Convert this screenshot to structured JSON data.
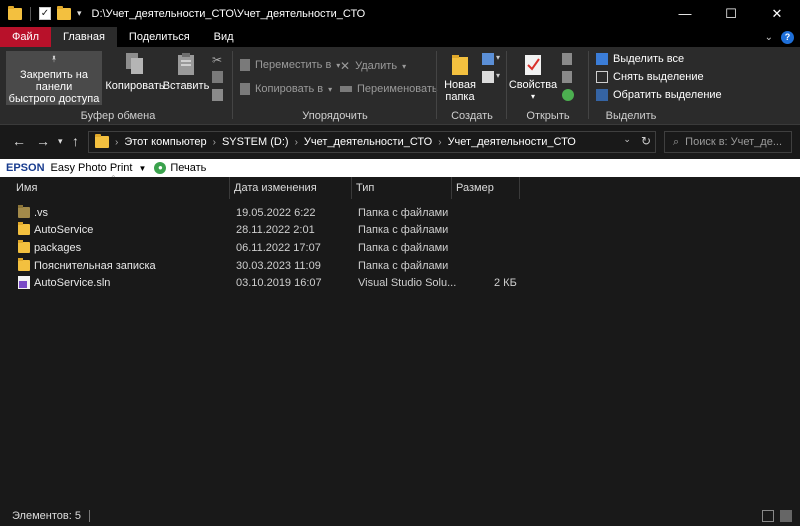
{
  "window": {
    "title": "D:\\Учет_деятельности_СТО\\Учет_деятельности_СТО",
    "minimize": "—",
    "maximize": "☐",
    "close": "✕"
  },
  "tabs": [
    {
      "label": "Файл"
    },
    {
      "label": "Главная"
    },
    {
      "label": "Поделиться"
    },
    {
      "label": "Вид"
    }
  ],
  "ribbon": {
    "clipboard": {
      "label": "Буфер обмена",
      "pin_line1": "Закрепить на панели",
      "pin_line2": "быстрого доступа",
      "copy": "Копировать",
      "paste": "Вставить"
    },
    "organize": {
      "label": "Упорядочить",
      "move_to": "Переместить в",
      "copy_to": "Копировать в",
      "delete": "Удалить",
      "rename": "Переименовать"
    },
    "create": {
      "label": "Создать",
      "new_folder_line1": "Новая",
      "new_folder_line2": "папка"
    },
    "open": {
      "label": "Открыть",
      "properties": "Свойства"
    },
    "select": {
      "label": "Выделить",
      "select_all": "Выделить все",
      "select_none": "Снять выделение",
      "invert": "Обратить выделение"
    }
  },
  "address": {
    "crumbs": [
      "Этот компьютер",
      "SYSTEM (D:)",
      "Учет_деятельности_СТО",
      "Учет_деятельности_СТО"
    ],
    "search_placeholder": "Поиск в: Учет_де..."
  },
  "epson": {
    "brand": "EPSON",
    "app": "Easy Photo Print",
    "print": "Печать"
  },
  "columns": {
    "name": "Имя",
    "date": "Дата изменения",
    "type": "Тип",
    "size": "Размер"
  },
  "files": [
    {
      "name": ".vs",
      "date": "19.05.2022 6:22",
      "type": "Папка с файлами",
      "size": "",
      "icon": "hidden-folder-icon"
    },
    {
      "name": "AutoService",
      "date": "28.11.2022 2:01",
      "type": "Папка с файлами",
      "size": "",
      "icon": "folder-icon"
    },
    {
      "name": "packages",
      "date": "06.11.2022 17:07",
      "type": "Папка с файлами",
      "size": "",
      "icon": "folder-icon"
    },
    {
      "name": "Пояснительная записка",
      "date": "30.03.2023 11:09",
      "type": "Папка с файлами",
      "size": "",
      "icon": "folder-icon"
    },
    {
      "name": "AutoService.sln",
      "date": "03.10.2019 16:07",
      "type": "Visual Studio Solu...",
      "size": "2 КБ",
      "icon": "sln-file-icon"
    }
  ],
  "status": {
    "items_count": "Элементов: 5"
  }
}
